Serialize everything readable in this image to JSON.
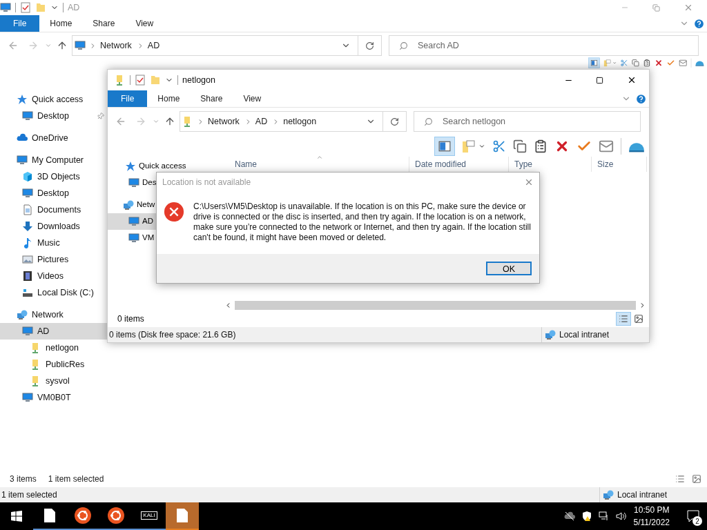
{
  "outer_window": {
    "title": "AD",
    "ribbon_tabs": [
      {
        "label": "File",
        "selected": true
      },
      {
        "label": "Home",
        "selected": false
      },
      {
        "label": "Share",
        "selected": false
      },
      {
        "label": "View",
        "selected": false
      }
    ],
    "breadcrumb": [
      "Network",
      "AD"
    ],
    "search": {
      "placeholder": "Search AD"
    },
    "sidebar": [
      {
        "label": "Quick access",
        "kind": "star",
        "selected": false,
        "pinned": false,
        "children": [
          {
            "label": "Desktop",
            "kind": "monitor",
            "selected": false,
            "pinned": true
          }
        ]
      },
      {
        "label": "OneDrive",
        "kind": "cloud",
        "selected": false,
        "pinned": false
      },
      {
        "label": "My Computer",
        "kind": "monitor",
        "selected": false,
        "pinned": false,
        "children": [
          {
            "label": "3D Objects",
            "kind": "cube",
            "selected": false,
            "pinned": false
          },
          {
            "label": "Desktop",
            "kind": "monitor",
            "selected": false,
            "pinned": false
          },
          {
            "label": "Documents",
            "kind": "document",
            "selected": false,
            "pinned": false
          },
          {
            "label": "Downloads",
            "kind": "download",
            "selected": false,
            "pinned": false
          },
          {
            "label": "Music",
            "kind": "music",
            "selected": false,
            "pinned": false
          },
          {
            "label": "Pictures",
            "kind": "picture",
            "selected": false,
            "pinned": false
          },
          {
            "label": "Videos",
            "kind": "film",
            "selected": false,
            "pinned": false
          },
          {
            "label": "Local Disk (C:)",
            "kind": "disk",
            "selected": false,
            "pinned": false
          }
        ]
      },
      {
        "label": "Network",
        "kind": "network",
        "selected": false,
        "pinned": false,
        "children": [
          {
            "label": "AD",
            "kind": "monitor",
            "selected": true,
            "pinned": false,
            "children": [
              {
                "label": "netlogon",
                "kind": "share",
                "selected": false,
                "pinned": false
              },
              {
                "label": "PublicRes",
                "kind": "share",
                "selected": false,
                "pinned": false
              },
              {
                "label": "sysvol",
                "kind": "share",
                "selected": false,
                "pinned": false
              }
            ]
          },
          {
            "label": "VM0B0T",
            "kind": "monitor",
            "selected": false,
            "pinned": false
          }
        ]
      }
    ],
    "item_count": "3 items",
    "selection_count": "1 item selected",
    "status_bar": {
      "text": "1 item selected",
      "zone": "Local intranet"
    }
  },
  "inner_window": {
    "title": "netlogon",
    "ribbon_tabs": [
      {
        "label": "File",
        "selected": true
      },
      {
        "label": "Home",
        "selected": false
      },
      {
        "label": "Share",
        "selected": false
      },
      {
        "label": "View",
        "selected": false
      }
    ],
    "breadcrumb": [
      "Network",
      "AD",
      "netlogon"
    ],
    "search": {
      "placeholder": "Search netlogon"
    },
    "sidebar": [
      {
        "label": "Quick access",
        "kind": "star",
        "selected": false
      },
      {
        "label": "Des",
        "kind": "monitor",
        "selected": false
      },
      {
        "label": "Netw",
        "kind": "network",
        "selected": false
      },
      {
        "label": "AD",
        "kind": "monitor",
        "selected": true
      },
      {
        "label": "VM",
        "kind": "monitor",
        "selected": false
      }
    ],
    "columns": [
      "Name",
      "Date modified",
      "Type",
      "Size"
    ],
    "item_count": "0 items",
    "status_bar": {
      "text": "0 items (Disk free space: 21.6 GB)",
      "zone": "Local intranet"
    }
  },
  "dialog": {
    "title": "Location is not available",
    "message": "C:\\Users\\VM5\\Desktop is unavailable. If the location is on this PC, make sure the device or drive is connected or the disc is inserted, and then try again. If the location is on a network, make sure you’re connected to the network or Internet, and then try again. If the location still can't be found, it might have been moved or deleted.",
    "button": "OK"
  },
  "taskbar": {
    "apps": [
      {
        "kind": "file",
        "active": false
      },
      {
        "kind": "ubuntu",
        "active": false
      },
      {
        "kind": "ubuntu",
        "active": false
      },
      {
        "kind": "kali",
        "label": "KALI",
        "active": false
      },
      {
        "kind": "file",
        "active": true
      }
    ],
    "time": "10:50 PM",
    "date": "5/11/2022",
    "notifications": "2"
  }
}
